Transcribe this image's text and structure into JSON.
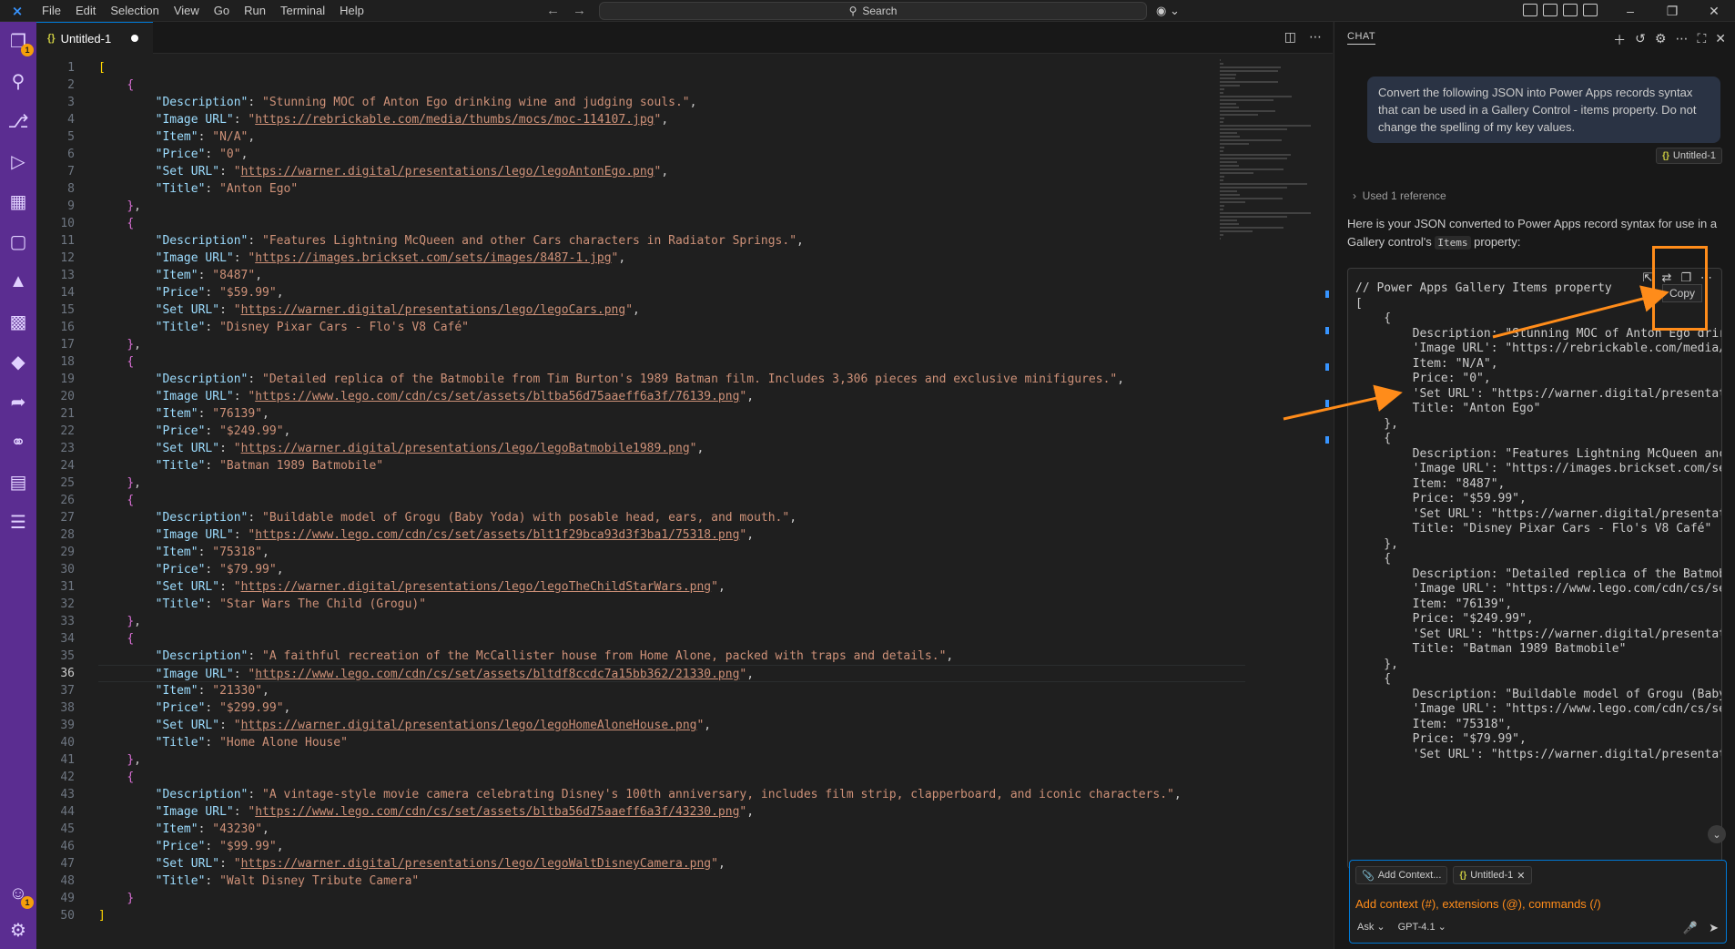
{
  "menu": [
    "File",
    "Edit",
    "Selection",
    "View",
    "Go",
    "Run",
    "Terminal",
    "Help"
  ],
  "search": {
    "label": "Search"
  },
  "tab": {
    "name": "Untitled-1"
  },
  "editor": {
    "active_line": 36,
    "lines": [
      [
        [
          "br1",
          "["
        ]
      ],
      [
        [
          "p",
          "    "
        ],
        [
          "br2",
          "{"
        ]
      ],
      [
        [
          "p",
          "        "
        ],
        [
          "k",
          "\"Description\""
        ],
        [
          "p",
          ": "
        ],
        [
          "s",
          "\"Stunning MOC of Anton Ego drinking wine and judging souls.\""
        ],
        [
          "p",
          ","
        ]
      ],
      [
        [
          "p",
          "        "
        ],
        [
          "k",
          "\"Image URL\""
        ],
        [
          "p",
          ": "
        ],
        [
          "s",
          "\""
        ],
        [
          "u",
          "https://rebrickable.com/media/thumbs/mocs/moc-114107.jpg"
        ],
        [
          "s",
          "\""
        ],
        [
          "p",
          ","
        ]
      ],
      [
        [
          "p",
          "        "
        ],
        [
          "k",
          "\"Item\""
        ],
        [
          "p",
          ": "
        ],
        [
          "s",
          "\"N/A\""
        ],
        [
          "p",
          ","
        ]
      ],
      [
        [
          "p",
          "        "
        ],
        [
          "k",
          "\"Price\""
        ],
        [
          "p",
          ": "
        ],
        [
          "s",
          "\"0\""
        ],
        [
          "p",
          ","
        ]
      ],
      [
        [
          "p",
          "        "
        ],
        [
          "k",
          "\"Set URL\""
        ],
        [
          "p",
          ": "
        ],
        [
          "s",
          "\""
        ],
        [
          "u",
          "https://warner.digital/presentations/lego/legoAntonEgo.png"
        ],
        [
          "s",
          "\""
        ],
        [
          "p",
          ","
        ]
      ],
      [
        [
          "p",
          "        "
        ],
        [
          "k",
          "\"Title\""
        ],
        [
          "p",
          ": "
        ],
        [
          "s",
          "\"Anton Ego\""
        ]
      ],
      [
        [
          "p",
          "    "
        ],
        [
          "br2",
          "}"
        ],
        [
          "p",
          ","
        ]
      ],
      [
        [
          "p",
          "    "
        ],
        [
          "br2",
          "{"
        ]
      ],
      [
        [
          "p",
          "        "
        ],
        [
          "k",
          "\"Description\""
        ],
        [
          "p",
          ": "
        ],
        [
          "s",
          "\"Features Lightning McQueen and other Cars characters in Radiator Springs.\""
        ],
        [
          "p",
          ","
        ]
      ],
      [
        [
          "p",
          "        "
        ],
        [
          "k",
          "\"Image URL\""
        ],
        [
          "p",
          ": "
        ],
        [
          "s",
          "\""
        ],
        [
          "u",
          "https://images.brickset.com/sets/images/8487-1.jpg"
        ],
        [
          "s",
          "\""
        ],
        [
          "p",
          ","
        ]
      ],
      [
        [
          "p",
          "        "
        ],
        [
          "k",
          "\"Item\""
        ],
        [
          "p",
          ": "
        ],
        [
          "s",
          "\"8487\""
        ],
        [
          "p",
          ","
        ]
      ],
      [
        [
          "p",
          "        "
        ],
        [
          "k",
          "\"Price\""
        ],
        [
          "p",
          ": "
        ],
        [
          "s",
          "\"$59.99\""
        ],
        [
          "p",
          ","
        ]
      ],
      [
        [
          "p",
          "        "
        ],
        [
          "k",
          "\"Set URL\""
        ],
        [
          "p",
          ": "
        ],
        [
          "s",
          "\""
        ],
        [
          "u",
          "https://warner.digital/presentations/lego/legoCars.png"
        ],
        [
          "s",
          "\""
        ],
        [
          "p",
          ","
        ]
      ],
      [
        [
          "p",
          "        "
        ],
        [
          "k",
          "\"Title\""
        ],
        [
          "p",
          ": "
        ],
        [
          "s",
          "\"Disney Pixar Cars - Flo's V8 Café\""
        ]
      ],
      [
        [
          "p",
          "    "
        ],
        [
          "br2",
          "}"
        ],
        [
          "p",
          ","
        ]
      ],
      [
        [
          "p",
          "    "
        ],
        [
          "br2",
          "{"
        ]
      ],
      [
        [
          "p",
          "        "
        ],
        [
          "k",
          "\"Description\""
        ],
        [
          "p",
          ": "
        ],
        [
          "s",
          "\"Detailed replica of the Batmobile from Tim Burton's 1989 Batman film. Includes 3,306 pieces and exclusive minifigures.\""
        ],
        [
          "p",
          ","
        ]
      ],
      [
        [
          "p",
          "        "
        ],
        [
          "k",
          "\"Image URL\""
        ],
        [
          "p",
          ": "
        ],
        [
          "s",
          "\""
        ],
        [
          "u",
          "https://www.lego.com/cdn/cs/set/assets/bltba56d75aaeff6a3f/76139.png"
        ],
        [
          "s",
          "\""
        ],
        [
          "p",
          ","
        ]
      ],
      [
        [
          "p",
          "        "
        ],
        [
          "k",
          "\"Item\""
        ],
        [
          "p",
          ": "
        ],
        [
          "s",
          "\"76139\""
        ],
        [
          "p",
          ","
        ]
      ],
      [
        [
          "p",
          "        "
        ],
        [
          "k",
          "\"Price\""
        ],
        [
          "p",
          ": "
        ],
        [
          "s",
          "\"$249.99\""
        ],
        [
          "p",
          ","
        ]
      ],
      [
        [
          "p",
          "        "
        ],
        [
          "k",
          "\"Set URL\""
        ],
        [
          "p",
          ": "
        ],
        [
          "s",
          "\""
        ],
        [
          "u",
          "https://warner.digital/presentations/lego/legoBatmobile1989.png"
        ],
        [
          "s",
          "\""
        ],
        [
          "p",
          ","
        ]
      ],
      [
        [
          "p",
          "        "
        ],
        [
          "k",
          "\"Title\""
        ],
        [
          "p",
          ": "
        ],
        [
          "s",
          "\"Batman 1989 Batmobile\""
        ]
      ],
      [
        [
          "p",
          "    "
        ],
        [
          "br2",
          "}"
        ],
        [
          "p",
          ","
        ]
      ],
      [
        [
          "p",
          "    "
        ],
        [
          "br2",
          "{"
        ]
      ],
      [
        [
          "p",
          "        "
        ],
        [
          "k",
          "\"Description\""
        ],
        [
          "p",
          ": "
        ],
        [
          "s",
          "\"Buildable model of Grogu (Baby Yoda) with posable head, ears, and mouth.\""
        ],
        [
          "p",
          ","
        ]
      ],
      [
        [
          "p",
          "        "
        ],
        [
          "k",
          "\"Image URL\""
        ],
        [
          "p",
          ": "
        ],
        [
          "s",
          "\""
        ],
        [
          "u",
          "https://www.lego.com/cdn/cs/set/assets/blt1f29bca93d3f3ba1/75318.png"
        ],
        [
          "s",
          "\""
        ],
        [
          "p",
          ","
        ]
      ],
      [
        [
          "p",
          "        "
        ],
        [
          "k",
          "\"Item\""
        ],
        [
          "p",
          ": "
        ],
        [
          "s",
          "\"75318\""
        ],
        [
          "p",
          ","
        ]
      ],
      [
        [
          "p",
          "        "
        ],
        [
          "k",
          "\"Price\""
        ],
        [
          "p",
          ": "
        ],
        [
          "s",
          "\"$79.99\""
        ],
        [
          "p",
          ","
        ]
      ],
      [
        [
          "p",
          "        "
        ],
        [
          "k",
          "\"Set URL\""
        ],
        [
          "p",
          ": "
        ],
        [
          "s",
          "\""
        ],
        [
          "u",
          "https://warner.digital/presentations/lego/legoTheChildStarWars.png"
        ],
        [
          "s",
          "\""
        ],
        [
          "p",
          ","
        ]
      ],
      [
        [
          "p",
          "        "
        ],
        [
          "k",
          "\"Title\""
        ],
        [
          "p",
          ": "
        ],
        [
          "s",
          "\"Star Wars The Child (Grogu)\""
        ]
      ],
      [
        [
          "p",
          "    "
        ],
        [
          "br2",
          "}"
        ],
        [
          "p",
          ","
        ]
      ],
      [
        [
          "p",
          "    "
        ],
        [
          "br2",
          "{"
        ]
      ],
      [
        [
          "p",
          "        "
        ],
        [
          "k",
          "\"Description\""
        ],
        [
          "p",
          ": "
        ],
        [
          "s",
          "\"A faithful recreation of the McCallister house from Home Alone, packed with traps and details.\""
        ],
        [
          "p",
          ","
        ]
      ],
      [
        [
          "p",
          "        "
        ],
        [
          "k",
          "\"Image URL\""
        ],
        [
          "p",
          ": "
        ],
        [
          "s",
          "\""
        ],
        [
          "u",
          "https://www.lego.com/cdn/cs/set/assets/bltdf8ccdc7a15bb362/21330.png"
        ],
        [
          "s",
          "\""
        ],
        [
          "p",
          ","
        ]
      ],
      [
        [
          "p",
          "        "
        ],
        [
          "k",
          "\"Item\""
        ],
        [
          "p",
          ": "
        ],
        [
          "s",
          "\"21330\""
        ],
        [
          "p",
          ","
        ]
      ],
      [
        [
          "p",
          "        "
        ],
        [
          "k",
          "\"Price\""
        ],
        [
          "p",
          ": "
        ],
        [
          "s",
          "\"$299.99\""
        ],
        [
          "p",
          ","
        ]
      ],
      [
        [
          "p",
          "        "
        ],
        [
          "k",
          "\"Set URL\""
        ],
        [
          "p",
          ": "
        ],
        [
          "s",
          "\""
        ],
        [
          "u",
          "https://warner.digital/presentations/lego/legoHomeAloneHouse.png"
        ],
        [
          "s",
          "\""
        ],
        [
          "p",
          ","
        ]
      ],
      [
        [
          "p",
          "        "
        ],
        [
          "k",
          "\"Title\""
        ],
        [
          "p",
          ": "
        ],
        [
          "s",
          "\"Home Alone House\""
        ]
      ],
      [
        [
          "p",
          "    "
        ],
        [
          "br2",
          "}"
        ],
        [
          "p",
          ","
        ]
      ],
      [
        [
          "p",
          "    "
        ],
        [
          "br2",
          "{"
        ]
      ],
      [
        [
          "p",
          "        "
        ],
        [
          "k",
          "\"Description\""
        ],
        [
          "p",
          ": "
        ],
        [
          "s",
          "\"A vintage-style movie camera celebrating Disney's 100th anniversary, includes film strip, clapperboard, and iconic characters.\""
        ],
        [
          "p",
          ","
        ]
      ],
      [
        [
          "p",
          "        "
        ],
        [
          "k",
          "\"Image URL\""
        ],
        [
          "p",
          ": "
        ],
        [
          "s",
          "\""
        ],
        [
          "u",
          "https://www.lego.com/cdn/cs/set/assets/bltba56d75aaeff6a3f/43230.png"
        ],
        [
          "s",
          "\""
        ],
        [
          "p",
          ","
        ]
      ],
      [
        [
          "p",
          "        "
        ],
        [
          "k",
          "\"Item\""
        ],
        [
          "p",
          ": "
        ],
        [
          "s",
          "\"43230\""
        ],
        [
          "p",
          ","
        ]
      ],
      [
        [
          "p",
          "        "
        ],
        [
          "k",
          "\"Price\""
        ],
        [
          "p",
          ": "
        ],
        [
          "s",
          "\"$99.99\""
        ],
        [
          "p",
          ","
        ]
      ],
      [
        [
          "p",
          "        "
        ],
        [
          "k",
          "\"Set URL\""
        ],
        [
          "p",
          ": "
        ],
        [
          "s",
          "\""
        ],
        [
          "u",
          "https://warner.digital/presentations/lego/legoWaltDisneyCamera.png"
        ],
        [
          "s",
          "\""
        ],
        [
          "p",
          ","
        ]
      ],
      [
        [
          "p",
          "        "
        ],
        [
          "k",
          "\"Title\""
        ],
        [
          "p",
          ": "
        ],
        [
          "s",
          "\"Walt Disney Tribute Camera\""
        ]
      ],
      [
        [
          "p",
          "    "
        ],
        [
          "br2",
          "}"
        ]
      ],
      [
        [
          "br1",
          "]"
        ]
      ]
    ]
  },
  "chat": {
    "title": "CHAT",
    "user_message": "Convert the following JSON into Power Apps records syntax that can be used in a Gallery Control - items property. Do not change the spelling of my key values.",
    "reference_chip": "Untitled-1",
    "used_reference": "Used 1 reference",
    "reply_before": "Here is your JSON converted to Power Apps record syntax for use in a Gallery control's ",
    "reply_code": "Items",
    "reply_after": " property:",
    "tooltip": "Copy",
    "code_lines": [
      "// Power Apps Gallery Items property",
      "[",
      "    {",
      "        Description: \"Stunning MOC of Anton Ego drir",
      "        'Image URL': \"https://rebrickable.com/media/",
      "        Item: \"N/A\",",
      "        Price: \"0\",",
      "        'Set URL': \"https://warner.digital/presentat",
      "        Title: \"Anton Ego\"",
      "    },",
      "    {",
      "        Description: \"Features Lightning McQueen anc",
      "        'Image URL': \"https://images.brickset.com/se",
      "        Item: \"8487\",",
      "        Price: \"$59.99\",",
      "        'Set URL': \"https://warner.digital/presentat",
      "        Title: \"Disney Pixar Cars - Flo's V8 Café\"",
      "    },",
      "    {",
      "        Description: \"Detailed replica of the Batmob",
      "        'Image URL': \"https://www.lego.com/cdn/cs/se",
      "        Item: \"76139\",",
      "        Price: \"$249.99\",",
      "        'Set URL': \"https://warner.digital/presentat",
      "        Title: \"Batman 1989 Batmobile\"",
      "    },",
      "    {",
      "        Description: \"Buildable model of Grogu (Baby",
      "        'Image URL': \"https://www.lego.com/cdn/cs/se",
      "        Item: \"75318\",",
      "        Price: \"$79.99\",",
      "        'Set URL': \"https://warner.digital/presentat"
    ],
    "input": {
      "add_context": "Add Context...",
      "file_chip": "Untitled-1",
      "placeholder": "Add context (#), extensions (@), commands (/)",
      "mode": "Ask",
      "model": "GPT-4.1"
    }
  },
  "colors": {
    "accent": "#0078d4",
    "activity_bar": "#5b2d91",
    "annotation": "#ff8c1a"
  },
  "badges": {
    "explorer": "1",
    "accounts": "1"
  }
}
